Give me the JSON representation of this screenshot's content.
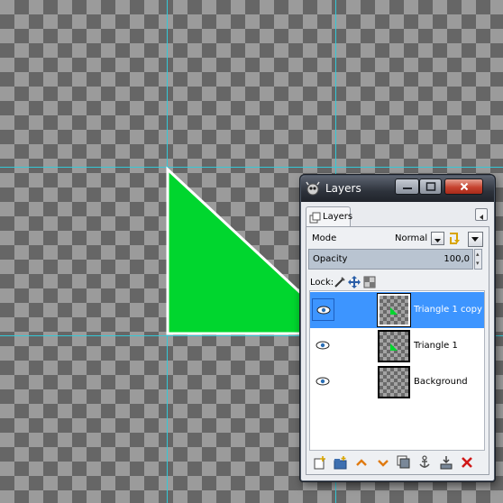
{
  "window": {
    "title": "Layers"
  },
  "tab": {
    "label": "Layers"
  },
  "mode": {
    "label": "Mode",
    "value": "Normal"
  },
  "opacity": {
    "label": "Opacity",
    "value": "100,0"
  },
  "lock": {
    "label": "Lock:"
  },
  "layers": [
    {
      "name": "Triangle 1 copy",
      "visible": true,
      "selected": true
    },
    {
      "name": "Triangle 1",
      "visible": true,
      "selected": false
    },
    {
      "name": "Background",
      "visible": true,
      "selected": false
    }
  ],
  "colors": {
    "triangle_fill": "#00d62e",
    "selection": "#3d95ff",
    "guide": "#35c8d6"
  },
  "toolbar_icons": [
    "new-layer-icon",
    "new-layer-group-icon",
    "raise-layer-icon",
    "lower-layer-icon",
    "duplicate-layer-icon",
    "anchor-layer-icon",
    "merge-down-icon",
    "delete-layer-icon"
  ]
}
